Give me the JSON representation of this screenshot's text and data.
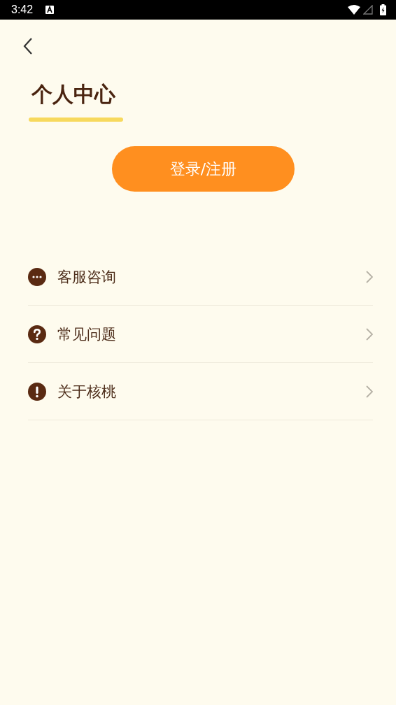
{
  "status_bar": {
    "time": "3:42"
  },
  "header": {
    "title": "个人中心"
  },
  "login_button": {
    "label": "登录/注册"
  },
  "menu": [
    {
      "kind": "chat",
      "label": "客服咨询"
    },
    {
      "kind": "question",
      "label": "常见问题"
    },
    {
      "kind": "info",
      "label": "关于核桃"
    }
  ]
}
